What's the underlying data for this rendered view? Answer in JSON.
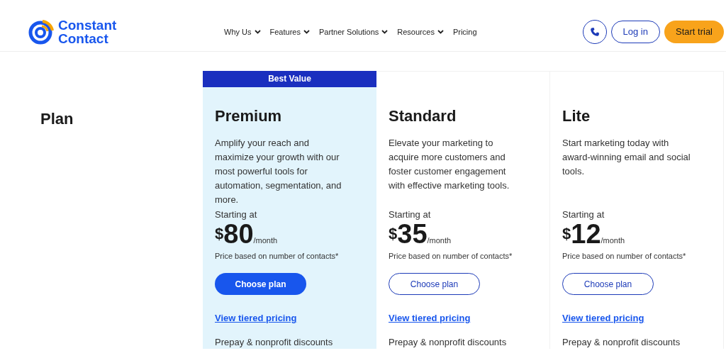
{
  "header": {
    "logo": [
      "Constant",
      "Contact"
    ],
    "nav": [
      {
        "label": "Why Us",
        "dropdown": true
      },
      {
        "label": "Features",
        "dropdown": true
      },
      {
        "label": "Partner Solutions",
        "dropdown": true
      },
      {
        "label": "Resources",
        "dropdown": true
      },
      {
        "label": "Pricing",
        "dropdown": false
      }
    ],
    "login": "Log in",
    "start_trial": "Start trial"
  },
  "plan_heading": "Plan",
  "plans": [
    {
      "badge": "Best Value",
      "featured": true,
      "name": "Premium",
      "description": "Amplify your reach and maximize your growth with our most powerful tools for automation, segmentation, and more.",
      "starting": "Starting at",
      "currency": "$",
      "price": "80",
      "period": "/month",
      "note": "Price based on number of contacts*",
      "button": "Choose plan",
      "link": "View tiered pricing",
      "discounts": "Prepay & nonprofit discounts"
    },
    {
      "featured": false,
      "name": "Standard",
      "description": "Elevate your marketing to acquire more customers and foster customer engagement with effective marketing tools.",
      "starting": "Starting at",
      "currency": "$",
      "price": "35",
      "period": "/month",
      "note": "Price based on number of contacts*",
      "button": "Choose plan",
      "link": "View tiered pricing",
      "discounts": "Prepay & nonprofit discounts"
    },
    {
      "featured": false,
      "name": "Lite",
      "description": "Start marketing today with award-winning email and social tools.",
      "starting": "Starting at",
      "currency": "$",
      "price": "12",
      "period": "/month",
      "note": "Price based on number of contacts*",
      "button": "Choose plan",
      "link": "View tiered pricing",
      "discounts": "Prepay & nonprofit discounts"
    }
  ]
}
